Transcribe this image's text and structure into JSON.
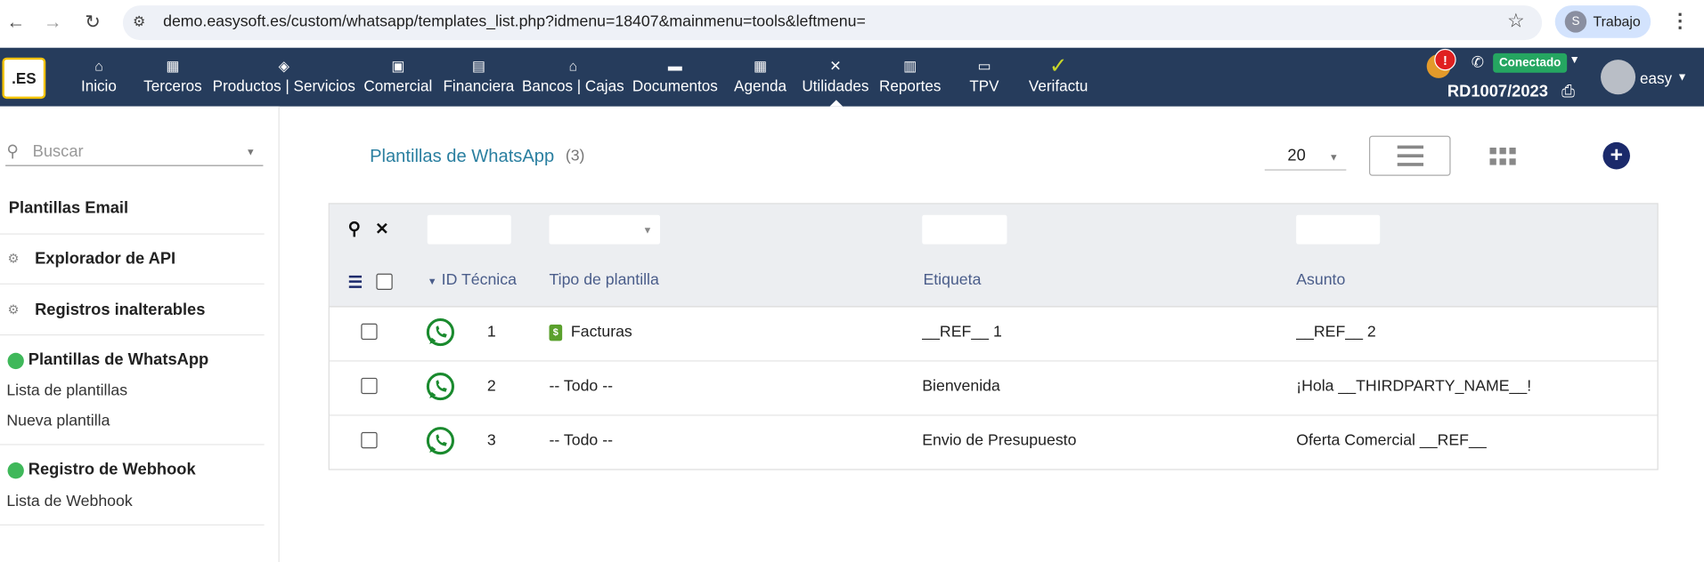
{
  "browser": {
    "url": "demo.easysoft.es/custom/whatsapp/templates_list.php?idmenu=18407&mainmenu=tools&leftmenu=",
    "profile_initial": "S",
    "profile_name": "Trabajo"
  },
  "topnav": {
    "logo": ".ES",
    "items": [
      {
        "label": "Inicio",
        "icon": "home-icon",
        "glyph": "⌂"
      },
      {
        "label": "Terceros",
        "icon": "building-icon",
        "glyph": "▦"
      },
      {
        "label": "Productos | Servicios",
        "icon": "box-icon",
        "glyph": "◈"
      },
      {
        "label": "Comercial",
        "icon": "briefcase-icon",
        "glyph": "▣"
      },
      {
        "label": "Financiera",
        "icon": "invoice-icon",
        "glyph": "▤"
      },
      {
        "label": "Bancos | Cajas",
        "icon": "bank-icon",
        "glyph": "⌂"
      },
      {
        "label": "Documentos",
        "icon": "folder-icon",
        "glyph": "▬"
      },
      {
        "label": "Agenda",
        "icon": "calendar-icon",
        "glyph": "▦"
      },
      {
        "label": "Utilidades",
        "icon": "tools-icon",
        "glyph": "✕"
      },
      {
        "label": "Reportes",
        "icon": "report-icon",
        "glyph": "▥"
      },
      {
        "label": "TPV",
        "icon": "pos-icon",
        "glyph": "▭"
      },
      {
        "label": "Verifactu",
        "icon": "check-icon",
        "glyph": "✓"
      }
    ],
    "notification_count": "!",
    "connection_status": "Conectado",
    "document_ref": "RD1007/2023",
    "user": "easy"
  },
  "sidebar": {
    "search_placeholder": "Buscar",
    "sections": [
      {
        "title": "Plantillas Email",
        "links": []
      },
      {
        "title": "Explorador de API",
        "links": []
      },
      {
        "title": "Registros inalterables",
        "links": []
      },
      {
        "title": "Plantillas de WhatsApp",
        "links": [
          "Lista de plantillas",
          "Nueva plantilla"
        ]
      },
      {
        "title": "Registro de Webhook",
        "links": [
          "Lista de Webhook"
        ]
      }
    ]
  },
  "main": {
    "title": "Plantillas de WhatsApp",
    "count": "(3)",
    "page_size": "20",
    "columns": [
      "ID Técnica",
      "Tipo de plantilla",
      "Etiqueta",
      "Asunto"
    ],
    "rows": [
      {
        "id": "1",
        "tipo": "Facturas",
        "etiqueta": "__REF__ 1",
        "asunto": "__REF__ 2"
      },
      {
        "id": "2",
        "tipo": "-- Todo --",
        "etiqueta": "Bienvenida",
        "asunto": "¡Hola __THIRDPARTY_NAME__!"
      },
      {
        "id": "3",
        "tipo": "-- Todo --",
        "etiqueta": "Envio de Presupuesto",
        "asunto": "Oferta Comercial __REF__"
      }
    ]
  },
  "colors": {
    "nav_bg": "#263c5c",
    "whatsapp_green": "#1a8a2e",
    "accent_title": "#2a7fa0",
    "connected": "#25a661"
  }
}
